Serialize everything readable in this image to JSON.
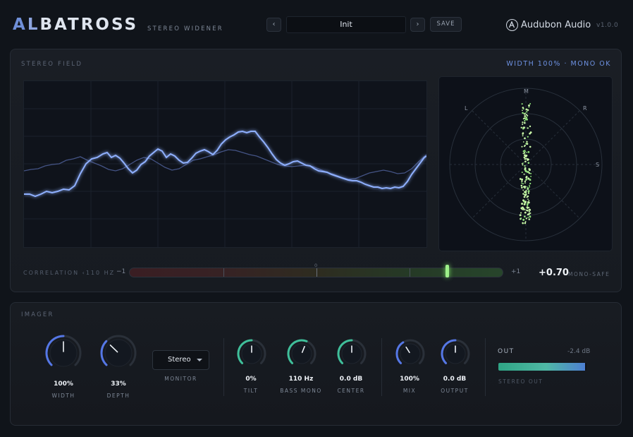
{
  "header": {
    "brand_prefix_a": "A",
    "brand_prefix_l": "L",
    "brand_rest": "BATROSS",
    "subtitle": "STEREO WIDENER",
    "preset_prev_label": "‹",
    "preset_next_label": "›",
    "preset_name": "Init",
    "save_label": "SAVE",
    "vendor": "Audubon Audio",
    "version": "v1.0.0"
  },
  "stereo_field": {
    "label": "STEREO FIELD",
    "status": "WIDTH 100% · MONO OK",
    "vectorscope_axes": {
      "m": "M",
      "l": "L",
      "r": "R",
      "s": "S"
    }
  },
  "correlation": {
    "label": "CORRELATION ‹110 HZ",
    "min_label": "−1",
    "max_label": "+1",
    "zero_label": "0",
    "value": 0.7,
    "value_text": "+0.70",
    "state": "MONO-SAFE"
  },
  "imager": {
    "label": "IMAGER",
    "knobs": [
      {
        "id": "width",
        "value_text": "100%",
        "label": "WIDTH",
        "fraction": 0.5,
        "color": "#5577e6"
      },
      {
        "id": "depth",
        "value_text": "33%",
        "label": "DEPTH",
        "fraction": 0.33,
        "color": "#5577e6"
      },
      {
        "id": "tilt",
        "value_text": "0%",
        "label": "TILT",
        "fraction": 0.5,
        "color": "#3fbf9a"
      },
      {
        "id": "bass-mono",
        "value_text": "110 Hz",
        "label": "BASS MONO",
        "fraction": 0.58,
        "color": "#3fbf9a"
      },
      {
        "id": "center",
        "value_text": "0.0 dB",
        "label": "CENTER",
        "fraction": 0.5,
        "color": "#3fbf9a"
      },
      {
        "id": "mix",
        "value_text": "100%",
        "label": "MIX",
        "fraction": 0.38,
        "color": "#5577e6"
      },
      {
        "id": "output",
        "value_text": "0.0 dB",
        "label": "OUTPUT",
        "fraction": 0.5,
        "color": "#5577e6"
      }
    ],
    "monitor": {
      "value": "Stereo",
      "label": "MONITOR"
    },
    "out": {
      "label": "OUT",
      "db": "-2.4 dB",
      "level": 0.98,
      "caption": "STEREO OUT"
    }
  },
  "colors": {
    "accent_blue": "#6e92e3",
    "accent_green": "#9ef08a",
    "spectrum_line": "#8fb0ff"
  }
}
